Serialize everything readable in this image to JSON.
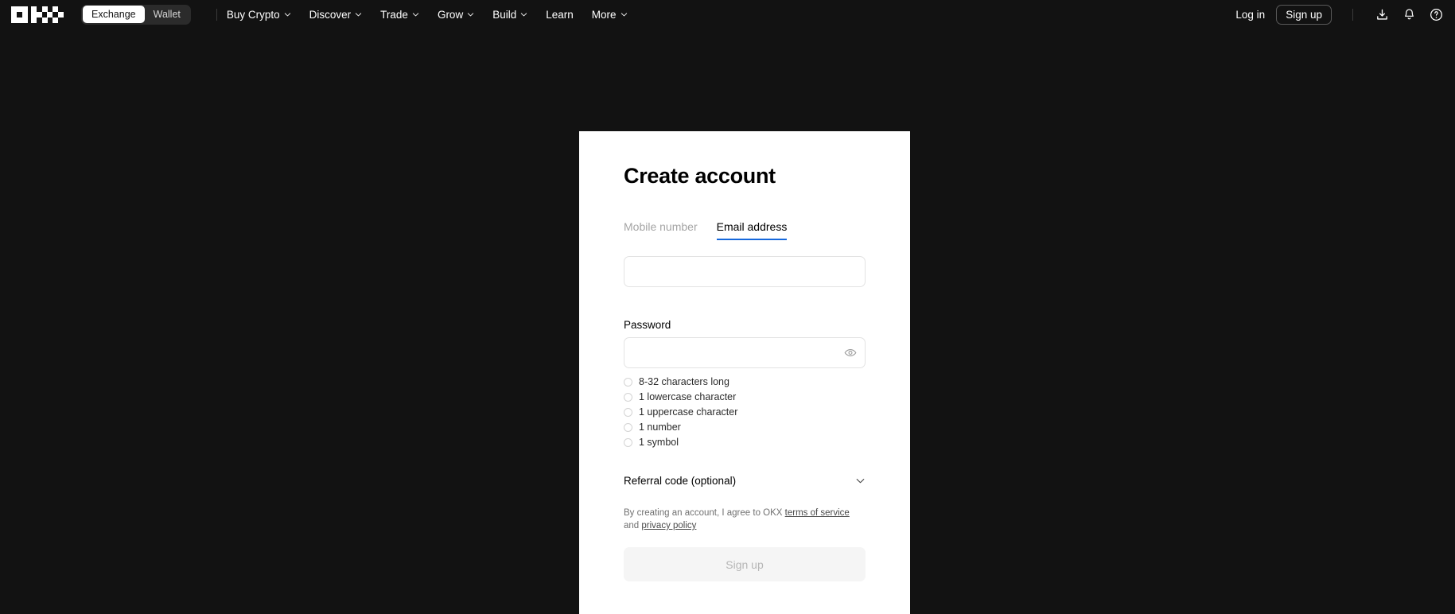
{
  "nav": {
    "logo_alt": "OKX",
    "segments": [
      {
        "label": "Exchange",
        "active": true
      },
      {
        "label": "Wallet",
        "active": false
      }
    ],
    "links": [
      {
        "label": "Buy Crypto",
        "has_caret": true
      },
      {
        "label": "Discover",
        "has_caret": true
      },
      {
        "label": "Trade",
        "has_caret": true
      },
      {
        "label": "Grow",
        "has_caret": true
      },
      {
        "label": "Build",
        "has_caret": true
      },
      {
        "label": "Learn",
        "has_caret": false
      },
      {
        "label": "More",
        "has_caret": true
      }
    ],
    "login_label": "Log in",
    "signup_label": "Sign up",
    "icons": [
      {
        "name": "download-icon"
      },
      {
        "name": "notification-bell-icon"
      },
      {
        "name": "help-circle-icon"
      }
    ]
  },
  "card": {
    "title": "Create account",
    "tabs": [
      {
        "label": "Mobile number",
        "active": false
      },
      {
        "label": "Email address",
        "active": true
      }
    ],
    "email": {
      "value": "",
      "placeholder": ""
    },
    "password": {
      "label": "Password",
      "value": "",
      "placeholder": "",
      "toggle_icon": "eye-icon"
    },
    "password_requirements": [
      "8-32 characters long",
      "1 lowercase character",
      "1 uppercase character",
      "1 number",
      "1 symbol"
    ],
    "referral": {
      "label": "Referral code (optional)",
      "chevron_icon": "chevron-down-icon"
    },
    "legal": {
      "prefix": "By creating an account, I agree to OKX ",
      "terms_link": "terms of service",
      "middle": " and ",
      "privacy_link": "privacy policy"
    },
    "submit_label": "Sign up"
  },
  "colors": {
    "page_background": "#121212",
    "card_background": "#ffffff",
    "accent_blue": "#1668dc",
    "disabled_button_bg": "#f5f5f5",
    "disabled_button_text": "#b6b6b6"
  }
}
